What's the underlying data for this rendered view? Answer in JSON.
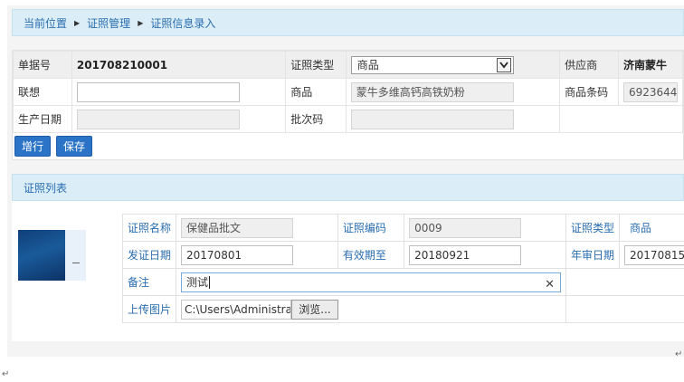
{
  "breadcrumb": {
    "items": [
      "当前位置",
      "证照管理",
      "证照信息录入"
    ]
  },
  "form": {
    "doc_no_label": "单据号",
    "doc_no_value": "201708210001",
    "cert_type_label": "证照类型",
    "cert_type_value": "商品",
    "supplier_label": "供应商",
    "supplier_value": "济南蒙牛",
    "assoc_label": "联想",
    "assoc_value": "",
    "product_label": "商品",
    "product_value": "蒙牛多维高钙高铁奶粉",
    "barcode_label": "商品条码",
    "barcode_value": "6923644",
    "prod_date_label": "生产日期",
    "prod_date_value": "",
    "batch_label": "批次码",
    "batch_value": ""
  },
  "buttons": {
    "add": "增行",
    "save": "保存"
  },
  "cert_list": {
    "title": "证照列表",
    "name_label": "证照名称",
    "name_value": "保健品批文",
    "code_label": "证照编码",
    "code_value": "0009",
    "type_label": "证照类型",
    "type_value": "商品",
    "issue_label": "发证日期",
    "issue_value": "20170801",
    "expire_label": "有效期至",
    "expire_value": "20180921",
    "annual_label": "年审日期",
    "annual_value": "20170815",
    "remark_label": "备注",
    "remark_value": "测试",
    "upload_label": "上传图片",
    "upload_path": "C:\\Users\\Administrator",
    "browse_label": "浏览..."
  },
  "marks": {
    "paragraph": "↵",
    "corner": "↵"
  }
}
